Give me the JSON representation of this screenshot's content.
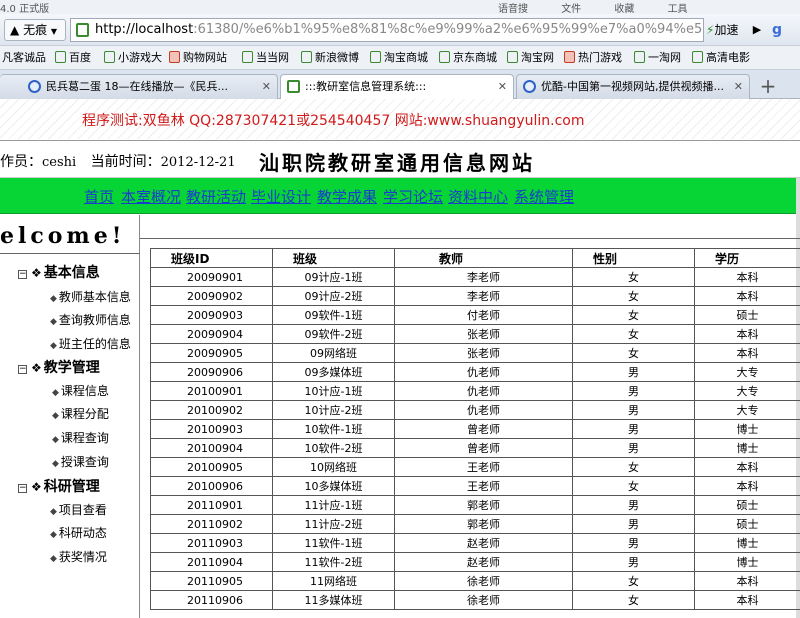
{
  "browser": {
    "topbar_left": "4.0 正式版",
    "topbar_right": [
      "语音搜",
      "文件",
      "收藏",
      "工具"
    ],
    "mode_label": "无痕",
    "url_host": "http://localhost",
    "url_rest": ":61380/%e6%b1%95%e8%81%8c%e9%99%a2%e6%95%99%e7%a0%94%e5%ae%",
    "speed_label": "加速",
    "play_label": "▶",
    "g_label": "g",
    "bookmarks": [
      {
        "label": "凡客诚品",
        "icon": "page-icon"
      },
      {
        "label": "百度",
        "icon": "page-icon"
      },
      {
        "label": "小游戏大",
        "icon": "page-icon"
      },
      {
        "label": "购物网站",
        "icon": "page-icon"
      },
      {
        "label": "当当网",
        "icon": "page-icon"
      },
      {
        "label": "新浪微博",
        "icon": "page-icon"
      },
      {
        "label": "淘宝商城",
        "icon": "page-icon"
      },
      {
        "label": "京东商城",
        "icon": "page-icon"
      },
      {
        "label": "淘宝网",
        "icon": "page-icon"
      },
      {
        "label": "热门游戏",
        "icon": "game-icon"
      },
      {
        "label": "一淘网",
        "icon": "page-icon"
      },
      {
        "label": "高清电影",
        "icon": "page-icon"
      }
    ],
    "tabs": [
      {
        "label": "民兵葛二蛋 18—在线播放—《民兵...",
        "active": false
      },
      {
        "label": ":::教研室信息管理系统:::",
        "active": true
      },
      {
        "label": "优酷-中国第一视频网站,提供视频播...",
        "active": false
      }
    ],
    "new_tab_label": "+"
  },
  "page": {
    "banner_text": "程序测试:双鱼林 QQ:287307421或254540457 网站:www.shuangyulin.com",
    "operator_label": "作员：",
    "operator_name": "ceshi",
    "time_label": "当前时间：",
    "time_value": "2012-12-21",
    "site_title": "汕职院教研室通用信息网站",
    "nav": [
      "首页",
      "本室概况",
      "教研活动",
      "毕业设计",
      "教学成果",
      "学习论坛",
      "资料中心",
      "系统管理"
    ],
    "welcome": "elcome!",
    "sidebar": [
      {
        "title": "基本信息",
        "items": [
          "教师基本信息",
          "查询教师信息",
          "班主任的信息"
        ]
      },
      {
        "title": "教学管理",
        "items": [
          "课程信息",
          "课程分配",
          "课程查询",
          "授课查询"
        ]
      },
      {
        "title": "科研管理",
        "items": [
          "项目查看",
          "科研动态",
          "获奖情况"
        ]
      }
    ],
    "table": {
      "headers": [
        "班级ID",
        "班级",
        "教师",
        "性别",
        "学历"
      ],
      "rows": [
        [
          "20090901",
          "09计应-1班",
          "李老师",
          "女",
          "本科"
        ],
        [
          "20090902",
          "09计应-2班",
          "李老师",
          "女",
          "本科"
        ],
        [
          "20090903",
          "09软件-1班",
          "付老师",
          "女",
          "硕士"
        ],
        [
          "20090904",
          "09软件-2班",
          "张老师",
          "女",
          "本科"
        ],
        [
          "20090905",
          "09网络班",
          "张老师",
          "女",
          "本科"
        ],
        [
          "20090906",
          "09多媒体班",
          "仇老师",
          "男",
          "大专"
        ],
        [
          "20100901",
          "10计应-1班",
          "仇老师",
          "男",
          "大专"
        ],
        [
          "20100902",
          "10计应-2班",
          "仇老师",
          "男",
          "大专"
        ],
        [
          "20100903",
          "10软件-1班",
          "曾老师",
          "男",
          "博士"
        ],
        [
          "20100904",
          "10软件-2班",
          "曾老师",
          "男",
          "博士"
        ],
        [
          "20100905",
          "10网络班",
          "王老师",
          "女",
          "本科"
        ],
        [
          "20100906",
          "10多媒体班",
          "王老师",
          "女",
          "本科"
        ],
        [
          "20110901",
          "11计应-1班",
          "郭老师",
          "男",
          "硕士"
        ],
        [
          "20110902",
          "11计应-2班",
          "郭老师",
          "男",
          "硕士"
        ],
        [
          "20110903",
          "11软件-1班",
          "赵老师",
          "男",
          "博士"
        ],
        [
          "20110904",
          "11软件-2班",
          "赵老师",
          "男",
          "博士"
        ],
        [
          "20110905",
          "11网络班",
          "徐老师",
          "女",
          "本科"
        ],
        [
          "20110906",
          "11多媒体班",
          "徐老师",
          "女",
          "本科"
        ]
      ]
    }
  }
}
